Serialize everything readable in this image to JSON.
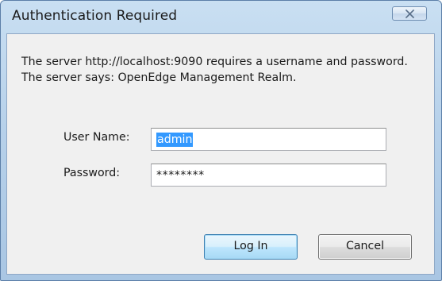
{
  "window": {
    "title": "Authentication Required"
  },
  "dialog": {
    "message": "The server http://localhost:9090 requires a username and password. The server says: OpenEdge Management Realm.",
    "username_label": "User Name:",
    "username_value": "admin",
    "password_label": "Password:",
    "password_value": "********",
    "login_label": "Log In",
    "cancel_label": "Cancel"
  },
  "icons": {
    "close": "close-icon"
  },
  "colors": {
    "frame_blue": "#b7d1ea",
    "selection": "#3399ff",
    "default_button": "#bee6fd"
  }
}
